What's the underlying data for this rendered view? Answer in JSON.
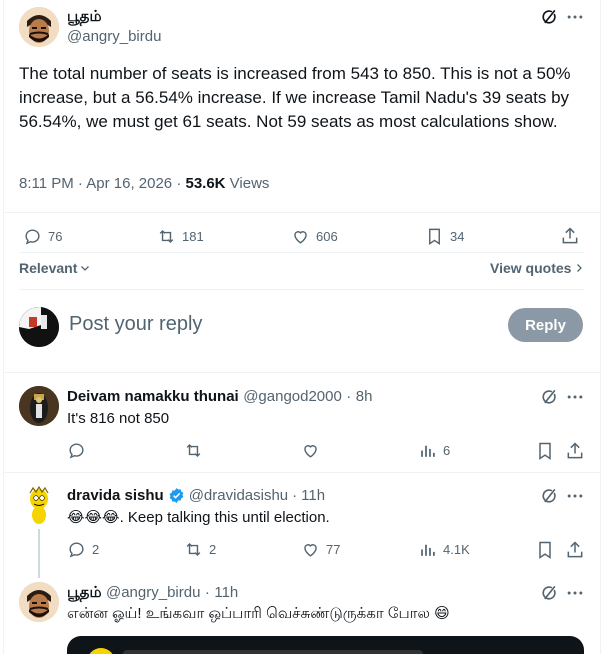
{
  "main_tweet": {
    "name": "பூதம்",
    "handle": "@angry_birdu",
    "text": "The total number of seats is increased from 543 to 850. This is not a 50% increase, but a 56.54% increase. If we increase Tamil Nadu's 39 seats by 56.54%, we must get 61 seats. Not 59 seats as most calculations show.",
    "timestamp": "8:11 PM · Apr 16, 2026 · ",
    "views_count": "53.6K",
    "views_label": " Views",
    "replies": "76",
    "retweets": "181",
    "likes": "606",
    "bookmarks": "34"
  },
  "filter": {
    "sort_label": "Relevant",
    "view_quotes_label": "View quotes"
  },
  "composer": {
    "placeholder": "Post your reply",
    "reply_button": "Reply"
  },
  "replies": [
    {
      "name": "Deivam namakku thunai",
      "handle": "@gangod2000",
      "time": "8h",
      "text": "It's 816 not 850",
      "replies": "",
      "retweets": "",
      "likes": "",
      "views": "6"
    },
    {
      "name": "dravida sishu",
      "handle": "@dravidasishu",
      "time": "11h",
      "emoji": "😂😂😂",
      "text": ". Keep talking this until election.",
      "replies": "2",
      "retweets": "2",
      "likes": "77",
      "views": "4.1K"
    },
    {
      "name": "பூதம்",
      "handle": "@angry_birdu",
      "time": "11h",
      "text": "என்ன ஓய்! உங்கவா ஒப்பாரி வெச்சுண்டுருக்கா போல 😄"
    }
  ],
  "colors": {
    "accent": "#1d9bf0",
    "text": "#0f1419",
    "muted": "#536471",
    "border": "#eff3f4",
    "reply_button_bg": "#8b98a5"
  }
}
